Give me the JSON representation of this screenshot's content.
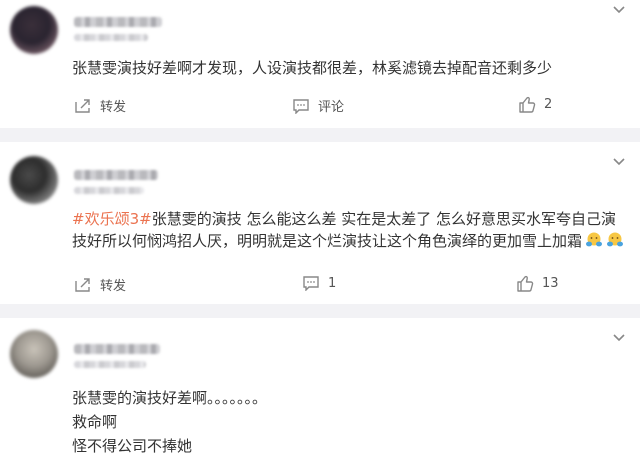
{
  "posts": [
    {
      "text": "张慧雯演技好差啊才发现，人设演技都很差，林奚滤镜去掉配音还剩多少",
      "repost_label": "转发",
      "comment_label": "评论",
      "like_count": "2"
    },
    {
      "tag": "#欢乐颂3#",
      "text": "张慧雯的演技 怎么能这么差 实在是太差了 怎么好意思买水军夸自己演技好所以何悯鸿招人厌，明明就是这个烂演技让这个角色演绎的更加雪上加霜",
      "repost_label": "转发",
      "comment_count": "1",
      "like_count": "13"
    },
    {
      "lines": [
        "张慧雯的演技好差啊。。。。。。。",
        "救命啊",
        "怪不得公司不捧她"
      ]
    }
  ],
  "colors": {
    "accent": "#eb7350",
    "text": "#333333",
    "separator": "#f2f2f5",
    "icon": "#888888"
  },
  "icons": {
    "menu": "chevron-down-icon",
    "repost": "share-icon",
    "comment": "comment-icon",
    "like": "thumbs-up-icon",
    "emoji": "cover-face-emoji-icon"
  }
}
